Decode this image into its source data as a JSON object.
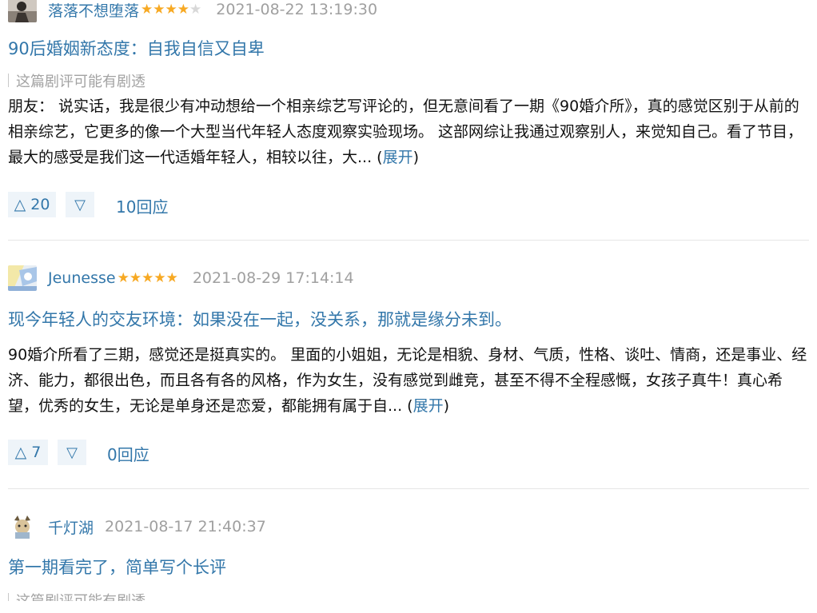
{
  "colors": {
    "link": "#3377aa",
    "star": "#f7a923",
    "meta": "#a0a0a0",
    "vote_bg": "#eef4f9"
  },
  "reviews": [
    {
      "username": "落落不想堕落",
      "rating": 4,
      "time": "2021-08-22 13:19:30",
      "title": "90后婚姻新态度：自我自信又自卑",
      "spoiler": "这篇剧评可能有剧透",
      "body": "朋友： 说实话，我是很少有冲动想给一个相亲综艺写评论的，但无意间看了一期《90婚介所》，真的感觉区别于从前的相亲综艺，它更多的像一个大型当代年轻人态度观察实验现场。 这部网综让我通过观察别人，来觉知自己。看了节目，最大的感受是我们这一代适婚年轻人，相较以往，大... (",
      "expand": "展开",
      "close": ")",
      "up": "△ 20",
      "down": "▽",
      "replies": "10回应"
    },
    {
      "username": "Jeunesse",
      "rating": 5,
      "time": "2021-08-29 17:14:14",
      "title": "现今年轻人的交友环境：如果没在一起，没关系，那就是缘分未到。",
      "body": "90婚介所看了三期，感觉还是挺真实的。 里面的小姐姐，无论是相貌、身材、气质，性格、谈吐、情商，还是事业、经济、能力，都很出色，而且各有各的风格，作为女生，没有感觉到雌竞，甚至不得不全程感慨，女孩子真牛！真心希望，优秀的女生，无论是单身还是恋爱，都能拥有属于自... (",
      "expand": "展开",
      "close": ")",
      "up": "△ 7",
      "down": "▽",
      "replies": "0回应"
    },
    {
      "username": "千灯湖",
      "time": "2021-08-17 21:40:37",
      "title": "第一期看完了，简单写个长评",
      "spoiler": "这篇剧评可能有剧透"
    }
  ]
}
